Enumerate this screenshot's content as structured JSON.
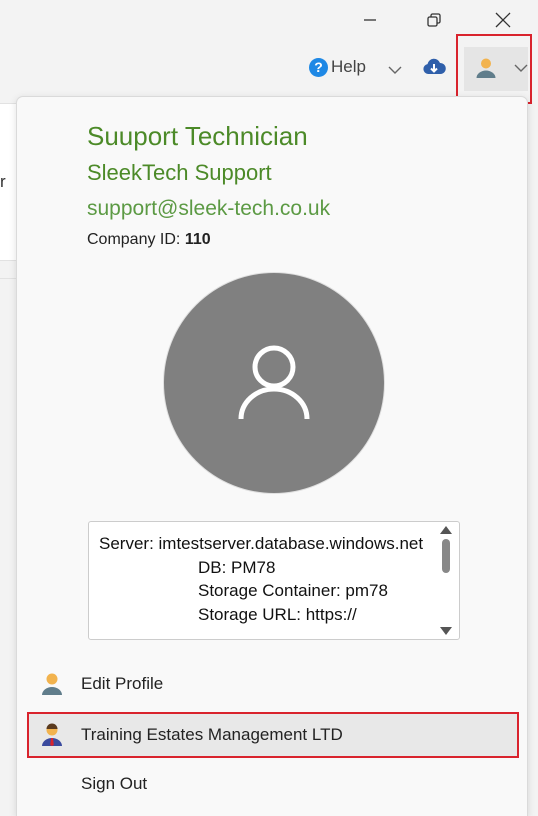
{
  "toolbar": {
    "help_label": "Help"
  },
  "profile": {
    "name": "Suuport Technician",
    "organization": "SleekTech Support",
    "email": "support@sleek-tech.co.uk",
    "company_id_label": "Company ID:",
    "company_id_value": "110"
  },
  "connection_info": {
    "server": "Server: imtestserver.database.windows.net",
    "db": "DB: PM78",
    "storage_container": "Storage Container: pm78",
    "storage_url": "Storage URL: https://"
  },
  "menu": {
    "edit_profile": "Edit Profile",
    "company": "Training Estates Management LTD",
    "sign_out": "Sign Out"
  },
  "background": {
    "left_edge_text": "r"
  },
  "colors": {
    "accent_green": "#4c8a28",
    "highlight_red": "#d9232d",
    "help_blue": "#1e88e5",
    "cloud_blue": "#2f5faa",
    "avatar_gray": "#808080"
  }
}
